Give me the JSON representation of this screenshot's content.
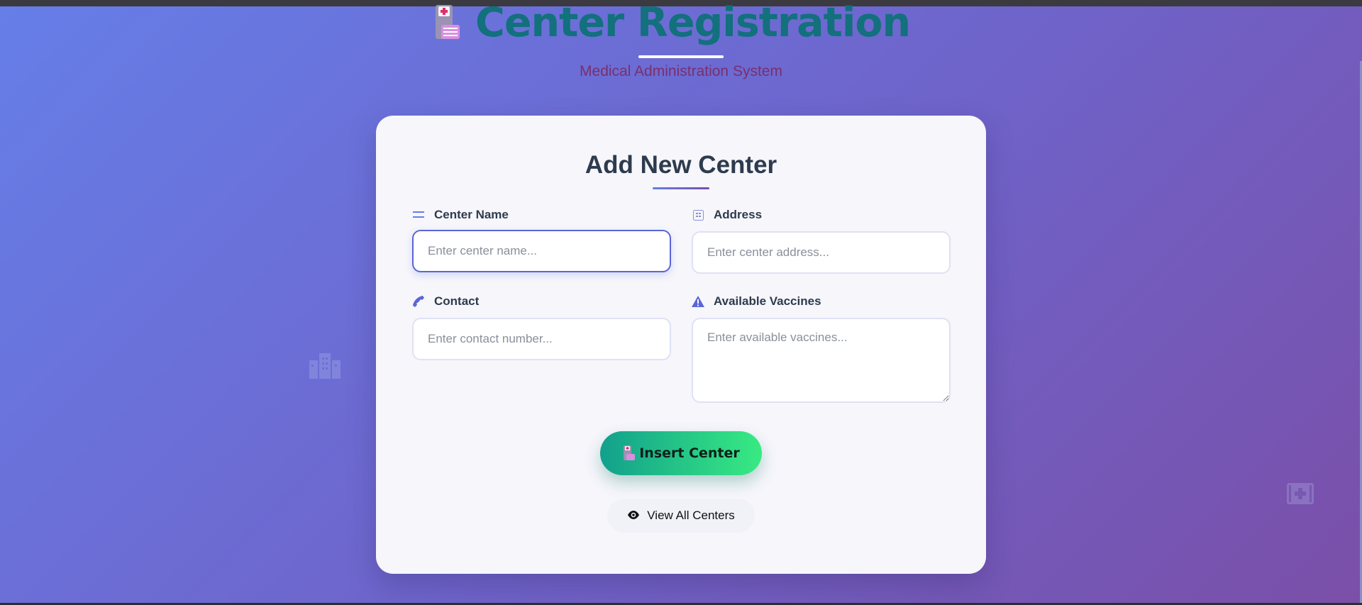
{
  "header": {
    "title": "Center Registration",
    "subtitle": "Medical Administration System"
  },
  "card": {
    "title": "Add New Center",
    "fields": {
      "center_name": {
        "label": "Center Name",
        "placeholder": "Enter center name...",
        "icon": "list-icon"
      },
      "address": {
        "label": "Address",
        "placeholder": "Enter center address...",
        "icon": "map-icon"
      },
      "contact": {
        "label": "Contact",
        "placeholder": "Enter contact number...",
        "icon": "phone-icon"
      },
      "vaccines": {
        "label": "Available Vaccines",
        "placeholder": "Enter available vaccines...",
        "icon": "warning-icon"
      }
    },
    "insert_button": {
      "label": "Insert Center",
      "icon": "hospital-icon"
    },
    "view_button": {
      "label": "View All Centers",
      "icon": "eye-icon"
    }
  },
  "colors": {
    "title": "#13707d",
    "accent": "#667ee8",
    "button_start": "#12a08c",
    "button_end": "#38ea82"
  }
}
